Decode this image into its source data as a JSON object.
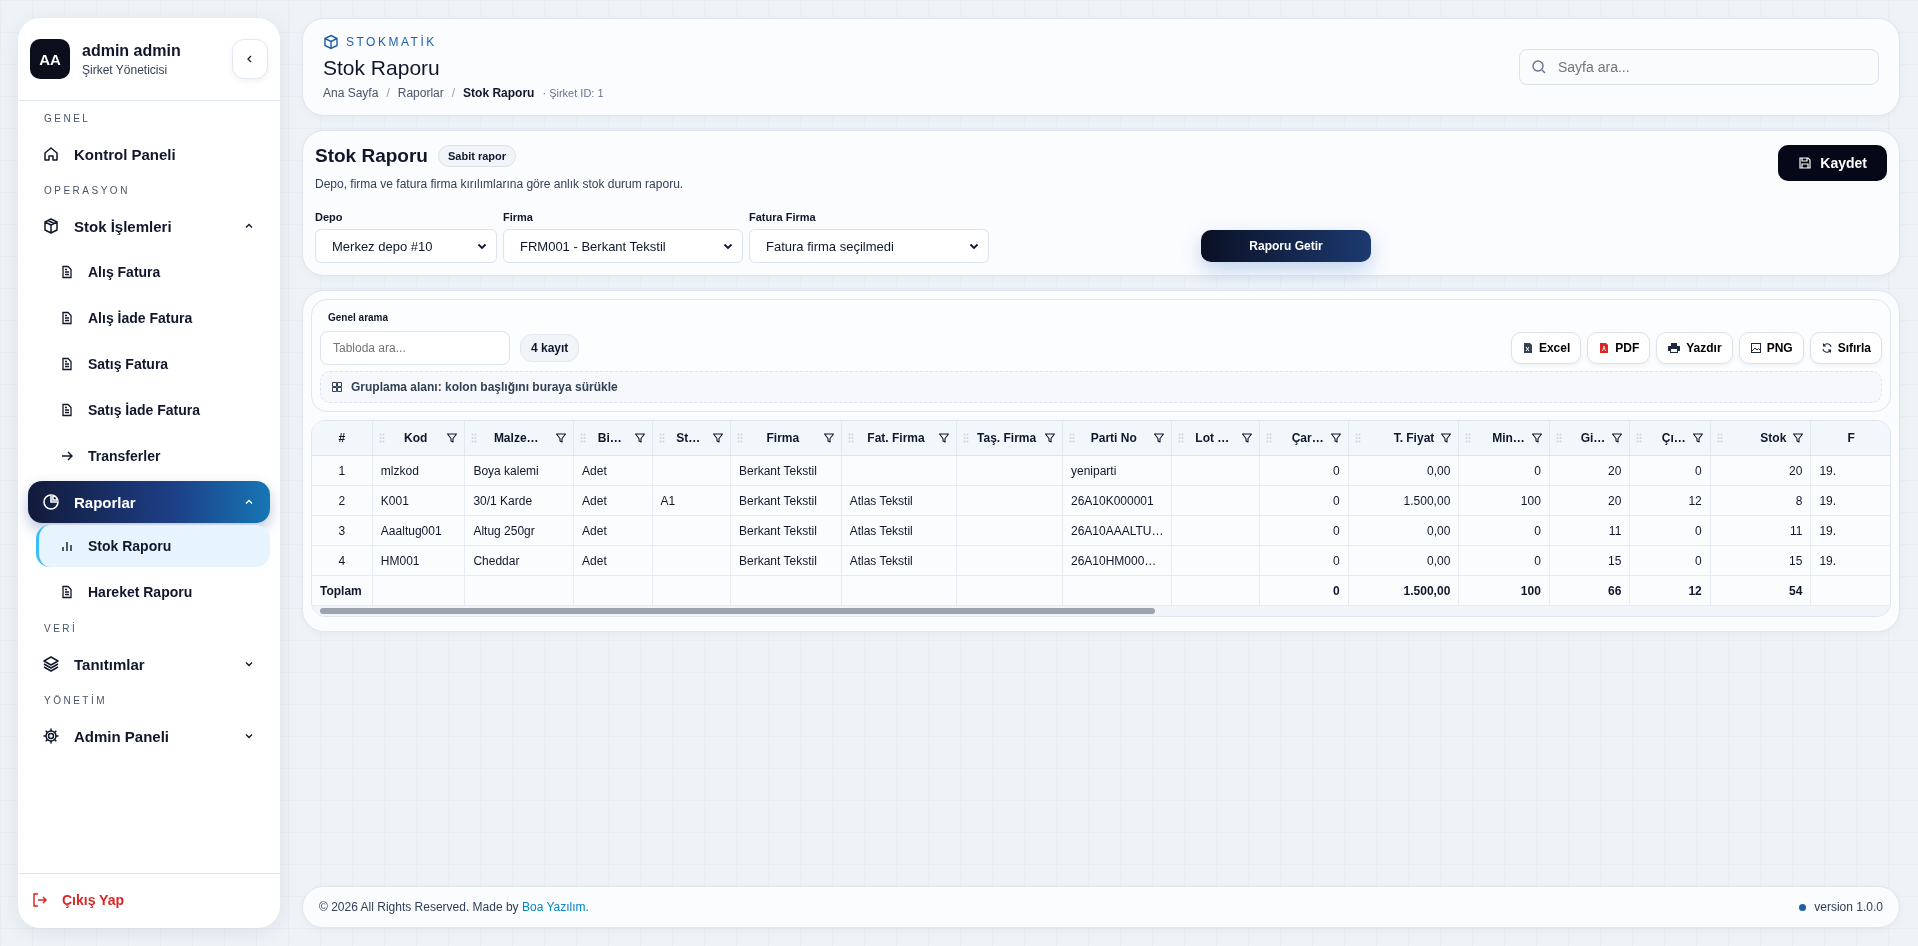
{
  "sidebar": {
    "user": {
      "initials": "AA",
      "name": "admin admin",
      "role": "Şirket Yöneticisi"
    },
    "sections": [
      {
        "title": "GENEL",
        "items": [
          {
            "label": "Kontrol Paneli",
            "selected": false
          }
        ]
      },
      {
        "title": "OPERASYON",
        "items": [
          {
            "label": "Stok İşlemleri",
            "selected": false,
            "expanded": true,
            "children": [
              {
                "label": "Alış Fatura",
                "selected": false
              },
              {
                "label": "Alış İade Fatura",
                "selected": false
              },
              {
                "label": "Satış Fatura",
                "selected": false
              },
              {
                "label": "Satış İade Fatura",
                "selected": false
              },
              {
                "label": "Transferler",
                "selected": false
              }
            ]
          },
          {
            "label": "Raporlar",
            "selected": true,
            "expanded": true,
            "children": [
              {
                "label": "Stok Raporu",
                "selected": true
              },
              {
                "label": "Hareket Raporu",
                "selected": false
              }
            ]
          }
        ]
      },
      {
        "title": "VERİ",
        "items": [
          {
            "label": "Tanıtımlar",
            "selected": false,
            "expanded": false
          }
        ]
      },
      {
        "title": "YÖNETİM",
        "items": [
          {
            "label": "Admin Paneli",
            "selected": false,
            "expanded": false
          }
        ]
      }
    ],
    "logout": "Çıkış Yap"
  },
  "header": {
    "brand": "STOKMATİK",
    "title": "Stok Raporu",
    "breadcrumb_separator": "/",
    "breadcrumbs": [
      {
        "label": "Ana Sayfa",
        "current": false
      },
      {
        "label": "Raporlar",
        "current": false
      },
      {
        "label": "Stok Raporu",
        "current": true
      }
    ],
    "company": "· Şirket ID: 1",
    "search": {
      "placeholder": "Sayfa ara..."
    }
  },
  "report": {
    "title": "Stok Raporu",
    "badge": "Sabit rapor",
    "description": "Depo, firma ve fatura firma kırılımlarına göre anlık stok durum raporu.",
    "save": "Kaydet",
    "filters": [
      {
        "label": "Depo",
        "value": "Merkez depo #10"
      },
      {
        "label": "Firma",
        "value": "FRM001 - Berkant Tekstil"
      },
      {
        "label": "Fatura Firma",
        "value": "Fatura firma seçilmedi"
      }
    ],
    "submit": "Raporu Getir"
  },
  "grid": {
    "search_label": "Genel arama",
    "search": {
      "placeholder": "Tabloda ara..."
    },
    "count": "4 kayıt",
    "tools": [
      "Excel",
      "PDF",
      "Yazdır",
      "PNG",
      "Sıfırla"
    ],
    "group_hint": "Gruplama alanı: kolon başlığını buraya sürükle",
    "columns": [
      {
        "label": "#",
        "kind": "index"
      },
      {
        "label": "Kod",
        "kind": "text"
      },
      {
        "label": "Malze…",
        "kind": "text"
      },
      {
        "label": "Bi…",
        "kind": "text"
      },
      {
        "label": "St…",
        "kind": "text"
      },
      {
        "label": "Firma",
        "kind": "text"
      },
      {
        "label": "Fat. Firma",
        "kind": "text"
      },
      {
        "label": "Taş. Firma",
        "kind": "text"
      },
      {
        "label": "Parti No",
        "kind": "text"
      },
      {
        "label": "Lot …",
        "kind": "text"
      },
      {
        "label": "Çar…",
        "kind": "number"
      },
      {
        "label": "T. Fiyat",
        "kind": "number"
      },
      {
        "label": "Min…",
        "kind": "number"
      },
      {
        "label": "Gi…",
        "kind": "number"
      },
      {
        "label": "Çı…",
        "kind": "number"
      },
      {
        "label": "Stok",
        "kind": "number"
      },
      {
        "label": "F",
        "kind": "text"
      }
    ],
    "rows": [
      [
        "1",
        "mlzkod",
        "Boya kalemi",
        "Adet",
        null,
        "Berkant Tekstil",
        null,
        null,
        "yeniparti",
        null,
        "0",
        "0,00",
        "0",
        "20",
        "0",
        "20",
        "19."
      ],
      [
        "2",
        "K001",
        "30/1 Karde",
        "Adet",
        "A1",
        "Berkant Tekstil",
        "Atlas Tekstil",
        null,
        "26A10K000001",
        null,
        "0",
        "1.500,00",
        "100",
        "20",
        "12",
        "8",
        "19."
      ],
      [
        "3",
        "Aaaltug001",
        "Altug 250gr",
        "Adet",
        null,
        "Berkant Tekstil",
        "Atlas Tekstil",
        null,
        "26A10AAALTU…",
        null,
        "0",
        "0,00",
        "0",
        "11",
        "0",
        "11",
        "19."
      ],
      [
        "4",
        "HM001",
        "Cheddar",
        "Adet",
        null,
        "Berkant Tekstil",
        "Atlas Tekstil",
        null,
        "26A10HM000…",
        null,
        "0",
        "0,00",
        "0",
        "15",
        "0",
        "15",
        "19."
      ]
    ],
    "totals": {
      "label": "Toplam",
      "values": [
        "0",
        "1.500,00",
        "100",
        "66",
        "12",
        "54"
      ]
    }
  },
  "footer": {
    "text": "© 2026 All Rights Reserved. Made by ",
    "link": "Boa Yazılım.",
    "version": "version 1.0.0"
  }
}
